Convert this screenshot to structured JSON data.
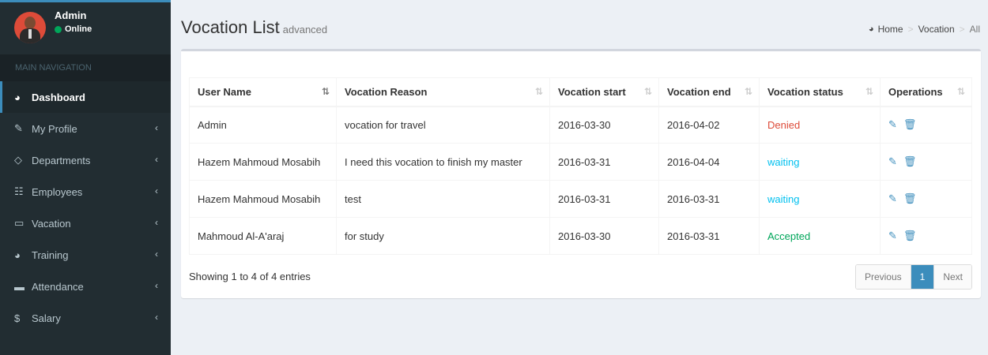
{
  "user": {
    "name": "Admin",
    "status": "Online"
  },
  "nav": {
    "header": "MAIN NAVIGATION",
    "items": [
      {
        "label": "Dashboard",
        "icon": "dashboard-icon",
        "glyph": "⬤"
      },
      {
        "label": "My Profile",
        "icon": "edit-icon",
        "glyph": "✎"
      },
      {
        "label": "Departments",
        "icon": "departments-icon",
        "glyph": "◇"
      },
      {
        "label": "Employees",
        "icon": "employees-icon",
        "glyph": "☷"
      },
      {
        "label": "Vacation",
        "icon": "laptop-icon",
        "glyph": "▭"
      },
      {
        "label": "Training",
        "icon": "pie-chart-icon",
        "glyph": "◕"
      },
      {
        "label": "Attendance",
        "icon": "folder-icon",
        "glyph": "▬"
      },
      {
        "label": "Salary",
        "icon": "dollar-icon",
        "glyph": "$"
      }
    ],
    "chevron": "‹"
  },
  "page": {
    "title": "Vocation List",
    "subtitle": "advanced"
  },
  "breadcrumb": {
    "home": "Home",
    "section": "Vocation",
    "current": "All",
    "sep": ">"
  },
  "table": {
    "headers": [
      "User Name",
      "Vocation Reason",
      "Vocation start",
      "Vocation end",
      "Vocation status",
      "Operations"
    ],
    "rows": [
      {
        "user": "Admin",
        "reason": "vocation for travel",
        "start": "2016-03-30",
        "end": "2016-04-02",
        "status": "Denied"
      },
      {
        "user": "Hazem Mahmoud Mosabih",
        "reason": "I need this vocation to finish my master",
        "start": "2016-03-31",
        "end": "2016-04-04",
        "status": "waiting"
      },
      {
        "user": "Hazem Mahmoud Mosabih",
        "reason": "test",
        "start": "2016-03-31",
        "end": "2016-03-31",
        "status": "waiting"
      },
      {
        "user": "Mahmoud Al-A'araj",
        "reason": "for study",
        "start": "2016-03-30",
        "end": "2016-03-31",
        "status": "Accepted"
      }
    ]
  },
  "info": "Showing 1 to 4 of 4 entries",
  "pagination": {
    "previous": "Previous",
    "current": "1",
    "next": "Next"
  },
  "colors": {
    "accent": "#3c8dbc",
    "denied": "#dd4b39",
    "waiting": "#00c0ef",
    "accepted": "#00a65a",
    "sidebar": "#222d32"
  }
}
